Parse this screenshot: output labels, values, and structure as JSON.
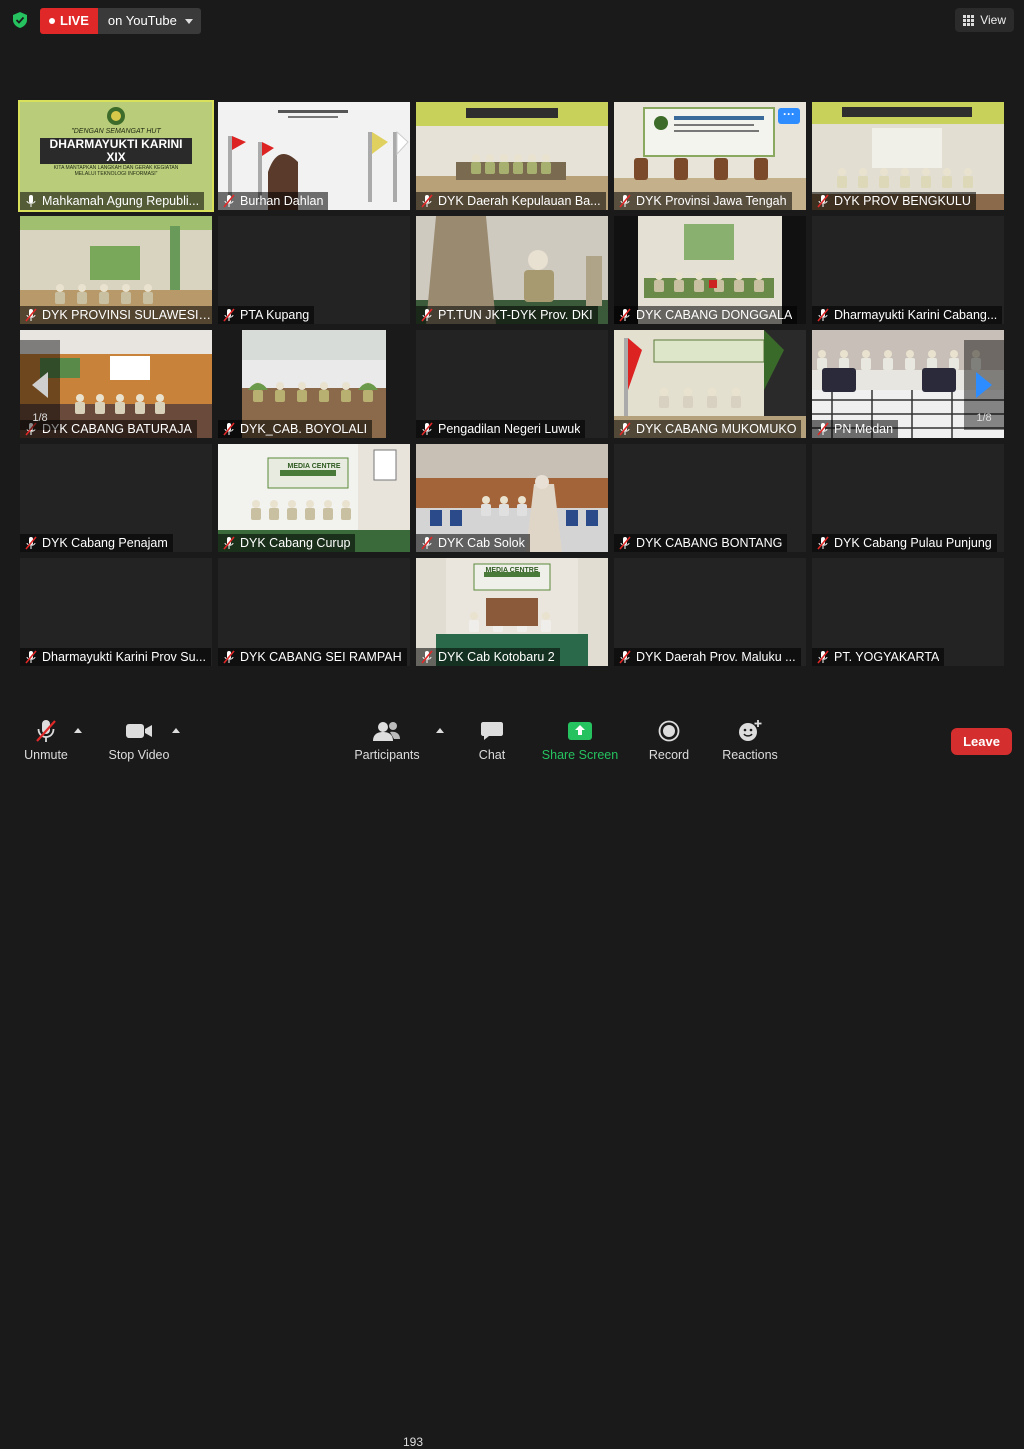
{
  "top": {
    "live_label": "LIVE",
    "stream_target": "on YouTube",
    "view_label": "View",
    "live_color": "#e02828"
  },
  "pagination": {
    "left_page": "1/8",
    "right_page": "1/8"
  },
  "tiles": [
    {
      "name": "Mahkamah Agung Republi...",
      "muted": false,
      "active": true,
      "scene": "banner"
    },
    {
      "name": "Burhan Dahlan",
      "muted": true,
      "scene": "flags"
    },
    {
      "name": "DYK Daerah Kepulauan Ba...",
      "muted": true,
      "scene": "hall-banner"
    },
    {
      "name": "DYK Provinsi Jawa Tengah",
      "muted": true,
      "scene": "stage-chairs",
      "has_more": true
    },
    {
      "name": "DYK PROV BENGKULU",
      "muted": true,
      "scene": "hall-banner-people"
    },
    {
      "name": "DYK PROVINSI SULAWESI T...",
      "muted": true,
      "scene": "green-room"
    },
    {
      "name": "PTA Kupang",
      "muted": true,
      "scene": "blank"
    },
    {
      "name": "PT.TUN JKT-DYK Prov. DKI",
      "muted": true,
      "scene": "office-people"
    },
    {
      "name": "DYK CABANG DONGGALA",
      "muted": true,
      "scene": "meeting-room"
    },
    {
      "name": "Dharmayukti Karini Cabang...",
      "muted": true,
      "scene": "blank"
    },
    {
      "name": "DYK CABANG BATURAJA",
      "muted": true,
      "scene": "orange-room"
    },
    {
      "name": "DYK_CAB. BOYOLALI",
      "muted": true,
      "scene": "hall-people"
    },
    {
      "name": "Pengadilan Negeri Luwuk",
      "muted": true,
      "scene": "blank"
    },
    {
      "name": "DYK CABANG MUKOMUKO",
      "muted": true,
      "scene": "flag-room"
    },
    {
      "name": "PN Medan",
      "muted": true,
      "scene": "tile-floor"
    },
    {
      "name": "DYK  Cabang Penajam",
      "muted": true,
      "scene": "blank"
    },
    {
      "name": "DYK Cabang Curup",
      "muted": true,
      "scene": "media-centre"
    },
    {
      "name": "DYK Cab Solok",
      "muted": true,
      "scene": "chairs-room"
    },
    {
      "name": "DYK CABANG BONTANG",
      "muted": true,
      "scene": "blank"
    },
    {
      "name": "DYK Cabang Pulau Punjung",
      "muted": true,
      "scene": "blank"
    },
    {
      "name": "Dharmayukti Karini Prov Su...",
      "muted": true,
      "scene": "blank"
    },
    {
      "name": "DYK CABANG SEI RAMPAH",
      "muted": true,
      "scene": "blank"
    },
    {
      "name": "DYK Cab Kotobaru 2",
      "muted": true,
      "scene": "media-centre-2"
    },
    {
      "name": "DYK Daerah Prov. Maluku ...",
      "muted": true,
      "scene": "blank"
    },
    {
      "name": "PT. YOGYAKARTA",
      "muted": true,
      "scene": "blank"
    }
  ],
  "banner": {
    "line1": "\"DENGAN SEMANGAT HUT",
    "line2": "DHARMAYUKTI KARINI XIX",
    "line3": "KITA MANTAPKAN LANGKAH DAN GERAK KEGIATAN",
    "line4": "MELALUI TEKNOLOGI INFORMASI\""
  },
  "media_centre_text": "MEDIA CENTRE",
  "toolbar": {
    "unmute": "Unmute",
    "stop_video": "Stop Video",
    "participants": "Participants",
    "participant_count": "193",
    "chat": "Chat",
    "share_screen": "Share Screen",
    "record": "Record",
    "reactions": "Reactions",
    "leave": "Leave",
    "share_color": "#25c25f",
    "leave_color": "#d42e2e"
  }
}
